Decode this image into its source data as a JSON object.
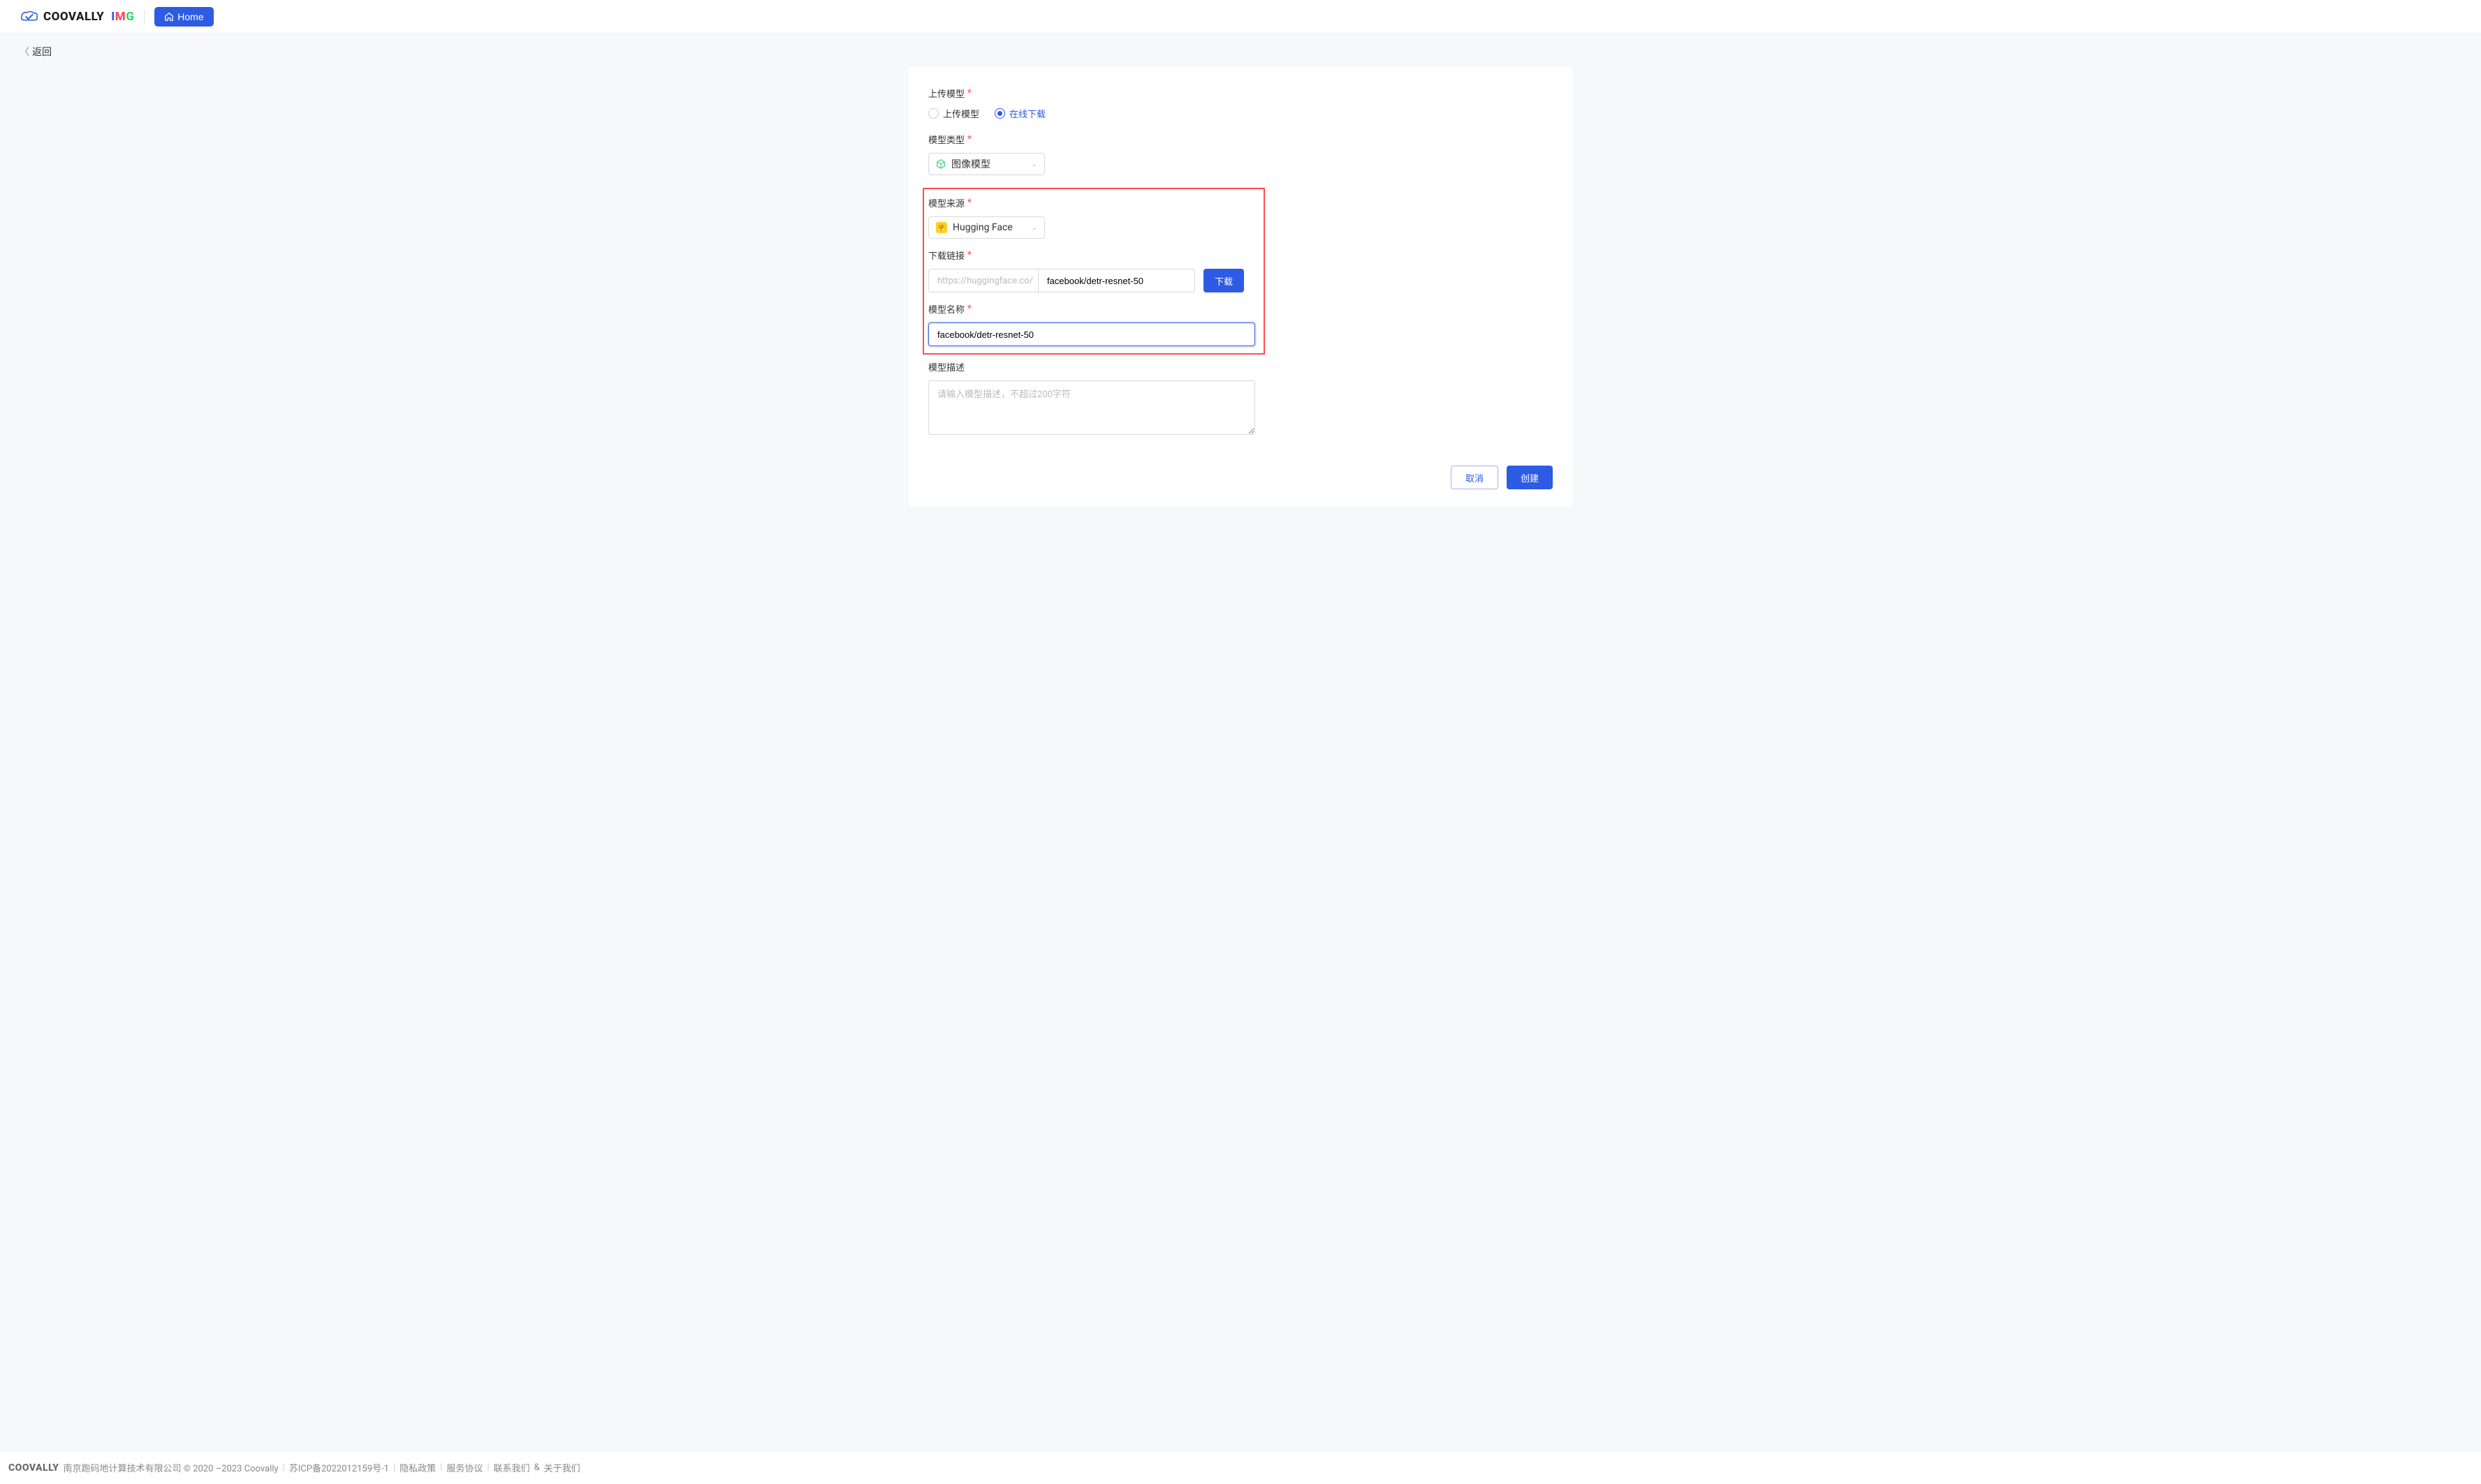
{
  "header": {
    "brand_main": "COOVALLY",
    "brand_sub_i": "I",
    "brand_sub_m": "M",
    "brand_sub_g": "G",
    "home_label": "Home"
  },
  "nav": {
    "back_label": "返回"
  },
  "form": {
    "upload_model_label": "上传模型",
    "radio_upload": "上传模型",
    "radio_online": "在线下载",
    "model_type_label": "模型类型",
    "model_type_value": "图像模型",
    "model_source_label": "模型来源",
    "model_source_value": "Hugging Face",
    "download_link_label": "下载链接",
    "download_prefix": "https://huggingface.co/",
    "download_path_value": "facebook/detr-resnet-50",
    "download_button": "下载",
    "model_name_label": "模型名称",
    "model_name_value": "facebook/detr-resnet-50",
    "model_desc_label": "模型描述",
    "model_desc_placeholder": "请输入模型描述，不超过200字符"
  },
  "actions": {
    "cancel": "取消",
    "create": "创建"
  },
  "footer": {
    "logo": "COOVALLY",
    "company": "南京跑码地计算技术有限公司 © 2020 –2023 Coovally",
    "icp": "苏ICP备2022012159号-1",
    "privacy": "隐私政策",
    "service": "服务协议",
    "contact": "联系我们",
    "amp": "&",
    "about": "关于我们"
  }
}
